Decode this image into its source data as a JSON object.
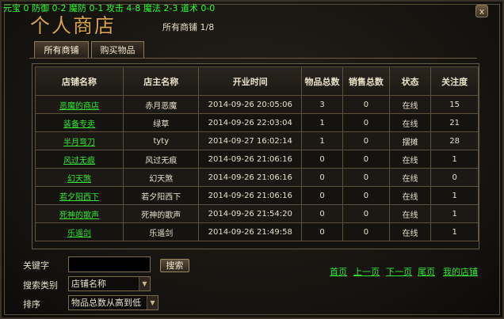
{
  "stats": "元宝 0 防御 0-2 魔防 0-1 攻击 4-8 魔法 2-3 道术 0-0",
  "window": {
    "title": "个人商店",
    "page_info": "所有商铺 1/8",
    "close_label": "x"
  },
  "tabs": [
    {
      "label": "所有商铺"
    },
    {
      "label": "购买物品"
    }
  ],
  "columns": [
    "店铺名称",
    "店主名称",
    "开业时间",
    "物品总数",
    "销售总数",
    "状态",
    "关注度"
  ],
  "rows": [
    {
      "shop": "恶魔的商店",
      "owner": "赤月恶魔",
      "opened": "2014-09-26 20:05:06",
      "items": "3",
      "sales": "0",
      "status": "在线",
      "follow": "15"
    },
    {
      "shop": "装备专卖",
      "owner": "绿草",
      "opened": "2014-09-26 22:03:04",
      "items": "1",
      "sales": "0",
      "status": "在线",
      "follow": "21"
    },
    {
      "shop": "半月弯刀",
      "owner": "tyty",
      "opened": "2014-09-27 16:02:14",
      "items": "1",
      "sales": "0",
      "status": "摆摊",
      "follow": "28"
    },
    {
      "shop": "风过无痕",
      "owner": "风过无痕",
      "opened": "2014-09-26 21:06:16",
      "items": "0",
      "sales": "0",
      "status": "在线",
      "follow": "1"
    },
    {
      "shop": "幻天煞",
      "owner": "幻天煞",
      "opened": "2014-09-26 21:06:16",
      "items": "0",
      "sales": "0",
      "status": "在线",
      "follow": "0"
    },
    {
      "shop": "若夕阳西下",
      "owner": "若夕阳西下",
      "opened": "2014-09-26 21:06:16",
      "items": "0",
      "sales": "0",
      "status": "在线",
      "follow": "1"
    },
    {
      "shop": "死神的歌声",
      "owner": "死神的歌声",
      "opened": "2014-09-26 21:54:20",
      "items": "0",
      "sales": "0",
      "status": "在线",
      "follow": "1"
    },
    {
      "shop": "乐遥剑",
      "owner": "乐遥剑",
      "opened": "2014-09-26 21:49:58",
      "items": "0",
      "sales": "0",
      "status": "在线",
      "follow": "1"
    }
  ],
  "search": {
    "keyword_label": "关键字",
    "keyword_value": "",
    "search_button": "搜索",
    "category_label": "搜索类别",
    "category_value": "店铺名称",
    "sort_label": "排序",
    "sort_value": "物品总数从高到低"
  },
  "pager": {
    "first": "首页",
    "prev": "上一页",
    "next": "下一页",
    "last": "尾页",
    "mine": "我的店铺"
  },
  "colors": {
    "link": "#34e834",
    "title": "#d9a24c",
    "stats": "#2cff2c"
  }
}
